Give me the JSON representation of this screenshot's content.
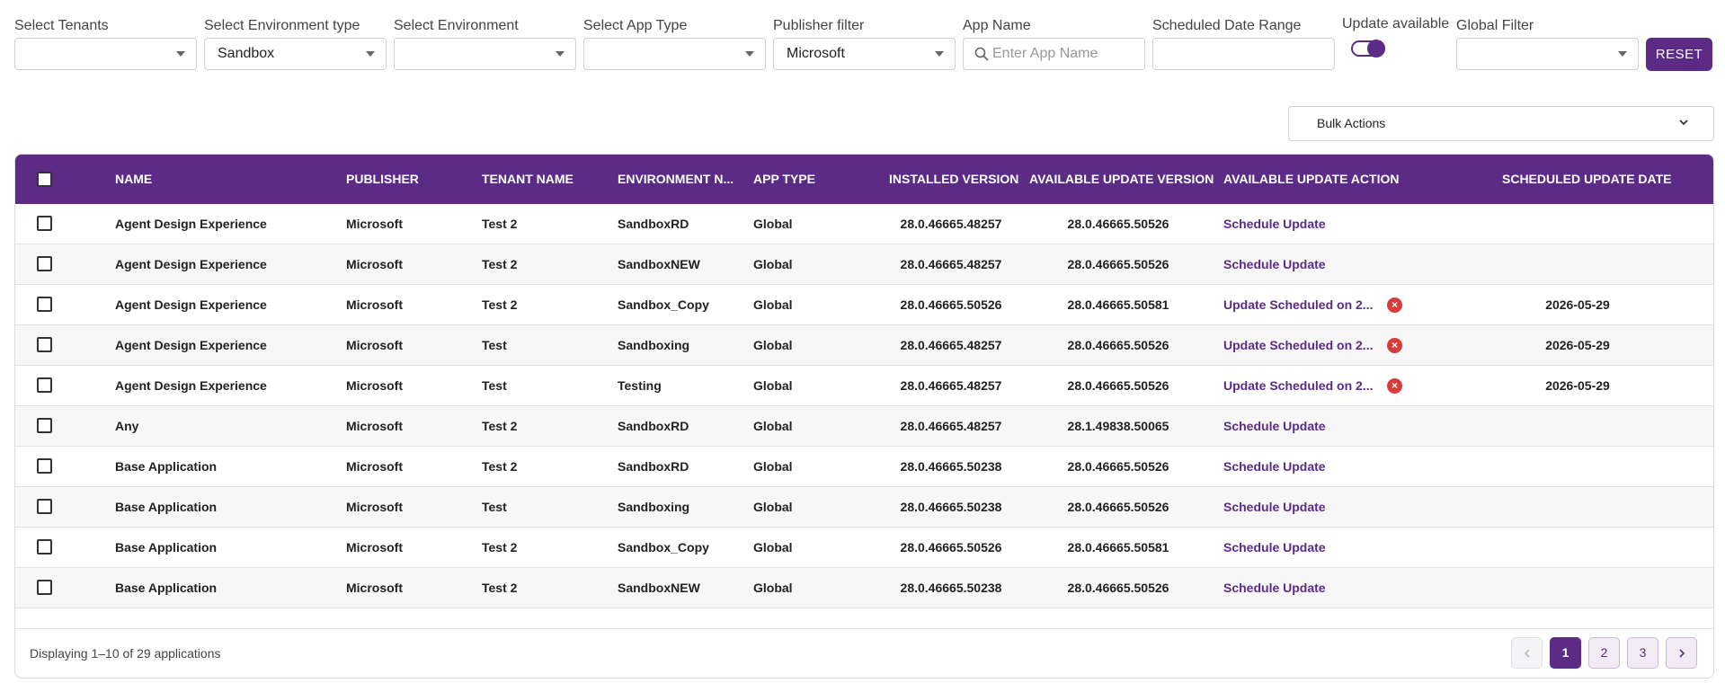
{
  "filters": {
    "tenants": {
      "label": "Select Tenants",
      "value": ""
    },
    "env_type": {
      "label": "Select Environment type",
      "value": "Sandbox"
    },
    "environment": {
      "label": "Select Environment",
      "value": ""
    },
    "app_type": {
      "label": "Select App Type",
      "value": ""
    },
    "publisher": {
      "label": "Publisher filter",
      "value": "Microsoft"
    },
    "app_name": {
      "label": "App Name",
      "placeholder": "Enter App Name",
      "value": ""
    },
    "date_range": {
      "label": "Scheduled Date Range",
      "value": ""
    },
    "update_available": {
      "label": "Update available",
      "checked": true
    },
    "global": {
      "label": "Global Filter",
      "value": ""
    },
    "reset_label": "RESET"
  },
  "bulk_actions": {
    "label": "Bulk Actions"
  },
  "table": {
    "headers": {
      "name": "NAME",
      "publisher": "PUBLISHER",
      "tenant": "TENANT NAME",
      "environment": "ENVIRONMENT N...",
      "app_type": "APP TYPE",
      "installed": "INSTALLED VERSION",
      "available": "AVAILABLE UPDATE VERSION",
      "action": "AVAILABLE UPDATE ACTION",
      "scheduled": "SCHEDULED UPDATE DATE"
    },
    "rows": [
      {
        "name": "Agent Design Experience",
        "publisher": "Microsoft",
        "tenant": "Test 2",
        "environment": "SandboxRD",
        "app_type": "Global",
        "installed": "28.0.46665.48257",
        "available": "28.0.46665.50526",
        "action": "Schedule Update",
        "scheduled": "",
        "cancellable": false
      },
      {
        "name": "Agent Design Experience",
        "publisher": "Microsoft",
        "tenant": "Test 2",
        "environment": "SandboxNEW",
        "app_type": "Global",
        "installed": "28.0.46665.48257",
        "available": "28.0.46665.50526",
        "action": "Schedule Update",
        "scheduled": "",
        "cancellable": false
      },
      {
        "name": "Agent Design Experience",
        "publisher": "Microsoft",
        "tenant": "Test 2",
        "environment": "Sandbox_Copy",
        "app_type": "Global",
        "installed": "28.0.46665.50526",
        "available": "28.0.46665.50581",
        "action": "Update Scheduled on 2...",
        "scheduled": "2026-05-29",
        "cancellable": true
      },
      {
        "name": "Agent Design Experience",
        "publisher": "Microsoft",
        "tenant": "Test",
        "environment": "Sandboxing",
        "app_type": "Global",
        "installed": "28.0.46665.48257",
        "available": "28.0.46665.50526",
        "action": "Update Scheduled on 2...",
        "scheduled": "2026-05-29",
        "cancellable": true
      },
      {
        "name": "Agent Design Experience",
        "publisher": "Microsoft",
        "tenant": "Test",
        "environment": "Testing",
        "app_type": "Global",
        "installed": "28.0.46665.48257",
        "available": "28.0.46665.50526",
        "action": "Update Scheduled on 2...",
        "scheduled": "2026-05-29",
        "cancellable": true
      },
      {
        "name": "Any",
        "publisher": "Microsoft",
        "tenant": "Test 2",
        "environment": "SandboxRD",
        "app_type": "Global",
        "installed": "28.0.46665.48257",
        "available": "28.1.49838.50065",
        "action": "Schedule Update",
        "scheduled": "",
        "cancellable": false
      },
      {
        "name": "Base Application",
        "publisher": "Microsoft",
        "tenant": "Test 2",
        "environment": "SandboxRD",
        "app_type": "Global",
        "installed": "28.0.46665.50238",
        "available": "28.0.46665.50526",
        "action": "Schedule Update",
        "scheduled": "",
        "cancellable": false
      },
      {
        "name": "Base Application",
        "publisher": "Microsoft",
        "tenant": "Test",
        "environment": "Sandboxing",
        "app_type": "Global",
        "installed": "28.0.46665.50238",
        "available": "28.0.46665.50526",
        "action": "Schedule Update",
        "scheduled": "",
        "cancellable": false
      },
      {
        "name": "Base Application",
        "publisher": "Microsoft",
        "tenant": "Test 2",
        "environment": "Sandbox_Copy",
        "app_type": "Global",
        "installed": "28.0.46665.50526",
        "available": "28.0.46665.50581",
        "action": "Schedule Update",
        "scheduled": "",
        "cancellable": false
      },
      {
        "name": "Base Application",
        "publisher": "Microsoft",
        "tenant": "Test 2",
        "environment": "SandboxNEW",
        "app_type": "Global",
        "installed": "28.0.46665.50238",
        "available": "28.0.46665.50526",
        "action": "Schedule Update",
        "scheduled": "",
        "cancellable": false
      }
    ]
  },
  "footer": {
    "summary": "Displaying 1–10 of 29 applications",
    "pages": [
      "1",
      "2",
      "3"
    ],
    "current_page": "1"
  },
  "icons": {
    "cancel": "cancel-schedule-icon",
    "prev": "chevron-left-icon",
    "next": "chevron-right-icon"
  },
  "colors": {
    "accent": "#5b2b86",
    "danger": "#d93b3b"
  }
}
